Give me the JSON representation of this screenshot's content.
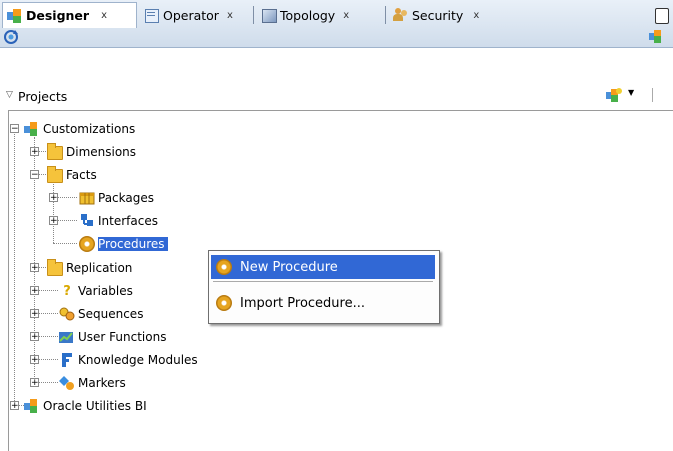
{
  "tabs": [
    {
      "label": "Designer",
      "close": "x",
      "active": true
    },
    {
      "label": "Operator",
      "close": "x",
      "active": false
    },
    {
      "label": "Topology",
      "close": "x",
      "active": false
    },
    {
      "label": "Security",
      "close": "x",
      "active": false
    }
  ],
  "projects": {
    "title": "Projects"
  },
  "tree": {
    "customizations": "Customizations",
    "dimensions": "Dimensions",
    "facts": "Facts",
    "packages": "Packages",
    "interfaces": "Interfaces",
    "procedures": "Procedures",
    "replication": "Replication",
    "variables": "Variables",
    "sequences": "Sequences",
    "user_functions": "User Functions",
    "knowledge_modules": "Knowledge Modules",
    "markers": "Markers",
    "oracle_utilities": "Oracle Utilities BI"
  },
  "context_menu": {
    "new_procedure": "New Procedure",
    "import_procedure": "Import Procedure..."
  },
  "colors": {
    "selection": "#3168d5",
    "folder": "#f5c33b"
  }
}
